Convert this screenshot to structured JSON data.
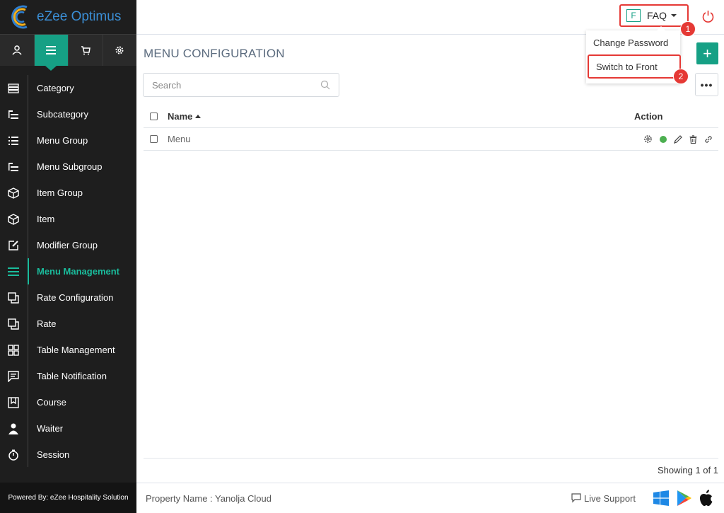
{
  "app": {
    "name": "eZee Optimus"
  },
  "topnav": {
    "items": [
      {
        "icon": "user-icon"
      },
      {
        "icon": "list-icon",
        "active": true
      },
      {
        "icon": "cart-icon"
      },
      {
        "icon": "gear-icon"
      }
    ]
  },
  "sidebar": {
    "items": [
      {
        "label": "Category",
        "icon": "category-icon"
      },
      {
        "label": "Subcategory",
        "icon": "subcategory-icon"
      },
      {
        "label": "Menu Group",
        "icon": "menu-group-icon"
      },
      {
        "label": "Menu Subgroup",
        "icon": "menu-subgroup-icon"
      },
      {
        "label": "Item Group",
        "icon": "box-icon"
      },
      {
        "label": "Item",
        "icon": "box-icon"
      },
      {
        "label": "Modifier Group",
        "icon": "edit-icon"
      },
      {
        "label": "Menu Management",
        "icon": "hamburger-icon",
        "active": true
      },
      {
        "label": "Rate Configuration",
        "icon": "copy-icon"
      },
      {
        "label": "Rate",
        "icon": "copy-icon"
      },
      {
        "label": "Table Management",
        "icon": "grid-icon"
      },
      {
        "label": "Table Notification",
        "icon": "message-icon"
      },
      {
        "label": "Course",
        "icon": "bookmark-icon"
      },
      {
        "label": "Waiter",
        "icon": "person-icon"
      },
      {
        "label": "Session",
        "icon": "timer-icon"
      }
    ],
    "powered_by": "Powered By: eZee Hospitality Solution"
  },
  "header": {
    "faq_letter": "F",
    "faq_label": "FAQ",
    "badge1": "1",
    "badge2": "2"
  },
  "dropdown": {
    "items": [
      "Change Password",
      "Switch to Front"
    ]
  },
  "main": {
    "title": "MENU CONFIGURATION",
    "search_placeholder": "Search",
    "add_label": "+",
    "more_label": "•••",
    "table": {
      "columns": [
        "Name",
        "Action"
      ],
      "rows": [
        {
          "name": "Menu"
        }
      ]
    },
    "showing": "Showing 1 of 1"
  },
  "footer": {
    "property": "Property Name : Yanolja Cloud",
    "live_support": "Live Support"
  },
  "colors": {
    "accent": "#16a085",
    "danger": "#e53935",
    "status_active": "#4caf50"
  }
}
